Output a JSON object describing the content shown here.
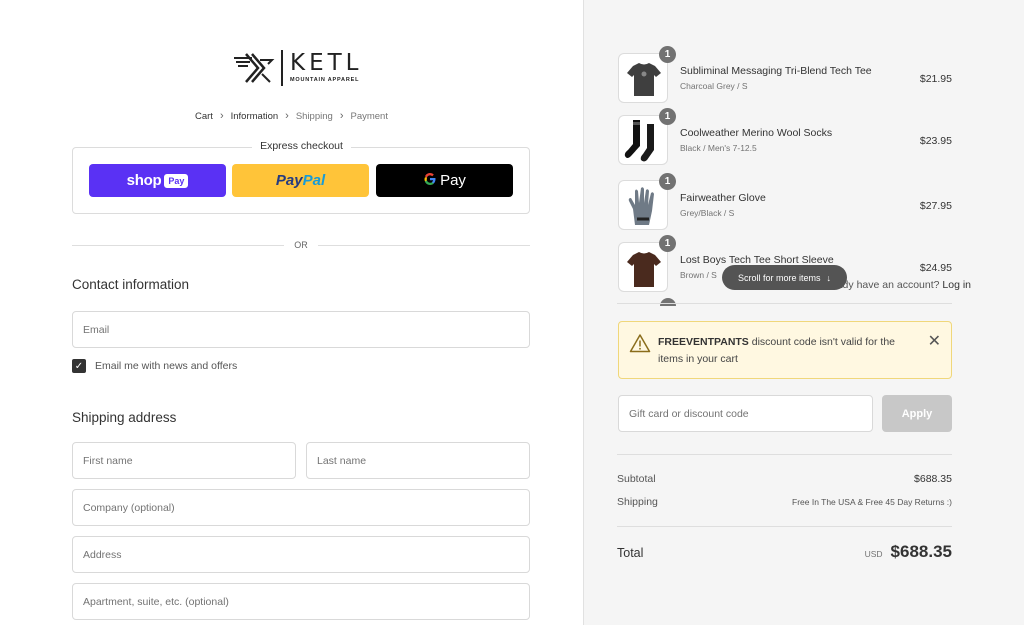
{
  "brand": {
    "name": "KETL",
    "tagline": "MOUNTAIN APPAREL"
  },
  "breadcrumb": [
    {
      "label": "Cart",
      "state": "link"
    },
    {
      "label": "Information",
      "state": "current"
    },
    {
      "label": "Shipping",
      "state": "upcoming"
    },
    {
      "label": "Payment",
      "state": "upcoming"
    }
  ],
  "express": {
    "title": "Express checkout",
    "shop_pay": {
      "text": "shop",
      "badge": "Pay",
      "color": "#5a31f4"
    },
    "paypal": {
      "part1": "Pay",
      "part2": "Pal",
      "color": "#ffc439"
    },
    "gpay": {
      "g": "G",
      "text": "Pay",
      "color": "#000000"
    }
  },
  "divider_or": "OR",
  "contact": {
    "title": "Contact information",
    "account_prompt": "Already have an account?",
    "login_link": "Log in",
    "email_placeholder": "Email",
    "newsletter_label": "Email me with news and offers",
    "newsletter_checked": true
  },
  "shipping": {
    "title": "Shipping address",
    "first_name_placeholder": "First name",
    "last_name_placeholder": "Last name",
    "company_placeholder": "Company (optional)",
    "address_placeholder": "Address",
    "apartment_placeholder": "Apartment, suite, etc. (optional)"
  },
  "cart": {
    "items": [
      {
        "name": "Subliminal Messaging Tri-Blend Tech Tee",
        "variant": "Charcoal Grey / S",
        "price": "$21.95",
        "qty": "1",
        "icon": "tshirt-grey"
      },
      {
        "name": "Coolweather Merino Wool Socks",
        "variant": "Black / Men's 7-12.5",
        "price": "$23.95",
        "qty": "1",
        "icon": "socks-black"
      },
      {
        "name": "Fairweather Glove",
        "variant": "Grey/Black / S",
        "price": "$27.95",
        "qty": "1",
        "icon": "glove-grey"
      },
      {
        "name": "Lost Boys Tech Tee Short Sleeve",
        "variant": "Brown / S",
        "price": "$24.95",
        "qty": "1",
        "icon": "tshirt-brown"
      }
    ],
    "scroll_hint": "Scroll for more items"
  },
  "alert": {
    "code": "FREEVENTPANTS",
    "message": " discount code isn't valid for the items in your cart",
    "color": "#fff8e1"
  },
  "discount": {
    "placeholder": "Gift card or discount code",
    "apply_label": "Apply"
  },
  "summary": {
    "subtotal_label": "Subtotal",
    "subtotal_value": "$688.35",
    "shipping_label": "Shipping",
    "shipping_value": "Free In The USA & Free 45 Day Returns :)",
    "total_label": "Total",
    "currency": "USD",
    "total_value": "$688.35"
  }
}
